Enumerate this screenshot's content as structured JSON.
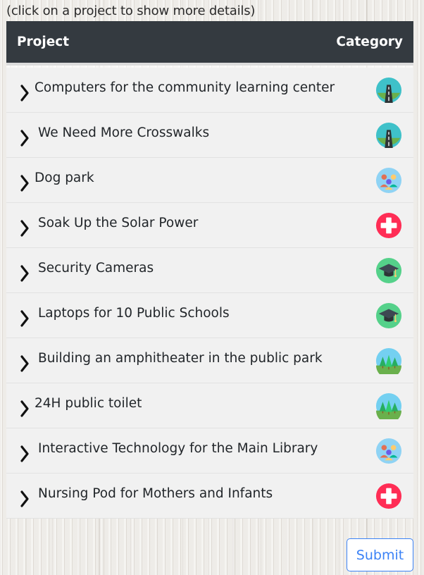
{
  "hint": "(click on a project to show more details)",
  "table": {
    "header_project": "Project",
    "header_category": "Category",
    "rows": [
      {
        "title": "Computers for the community learning center",
        "category_icon": "road-icon"
      },
      {
        "title": "We Need More Crosswalks",
        "category_icon": "road-icon"
      },
      {
        "title": "Dog park",
        "category_icon": "community-icon"
      },
      {
        "title": "Soak Up the Solar Power",
        "category_icon": "health-icon"
      },
      {
        "title": "Security Cameras",
        "category_icon": "education-icon"
      },
      {
        "title": "Laptops for 10 Public Schools",
        "category_icon": "education-icon"
      },
      {
        "title": "Building an amphitheater in the public park",
        "category_icon": "parks-icon"
      },
      {
        "title": "24H public toilet",
        "category_icon": "parks-icon"
      },
      {
        "title": "Interactive Technology for the Main Library",
        "category_icon": "community-icon"
      },
      {
        "title": "Nursing Pod for Mothers and Infants",
        "category_icon": "health-icon"
      }
    ]
  },
  "submit_label": "Submit",
  "colors": {
    "header_bg": "#343a40",
    "row_bg": "#f1f1f1",
    "accent": "#3b82f6"
  }
}
